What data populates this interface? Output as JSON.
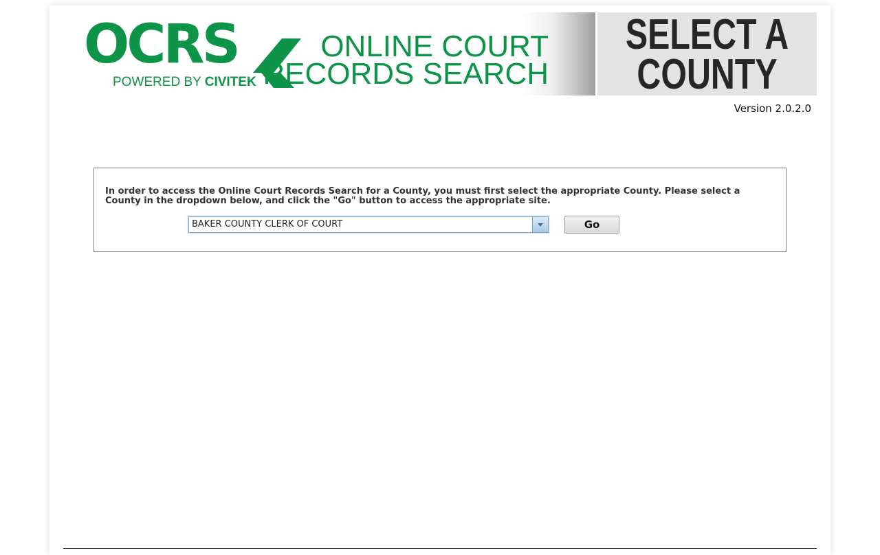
{
  "header": {
    "logo_text": "OCRS",
    "logo_tagline_prefix": "POWERED BY ",
    "logo_tagline_brand": "CIVITEK",
    "site_title": "ONLINE COURT\nRECORDS SEARCH",
    "panel_heading": "SELECT A\nCOUNTY",
    "version": "Version 2.0.2.0",
    "brand_color": "#0d9448"
  },
  "county_form": {
    "instructions": "In order to access the Online Court Records Search for a County, you must first select the appropriate County. Please select a County in the dropdown below, and click the \"Go\" button to access the appropriate site.",
    "selected_county": "BAKER COUNTY CLERK OF COURT",
    "go_label": "Go"
  }
}
